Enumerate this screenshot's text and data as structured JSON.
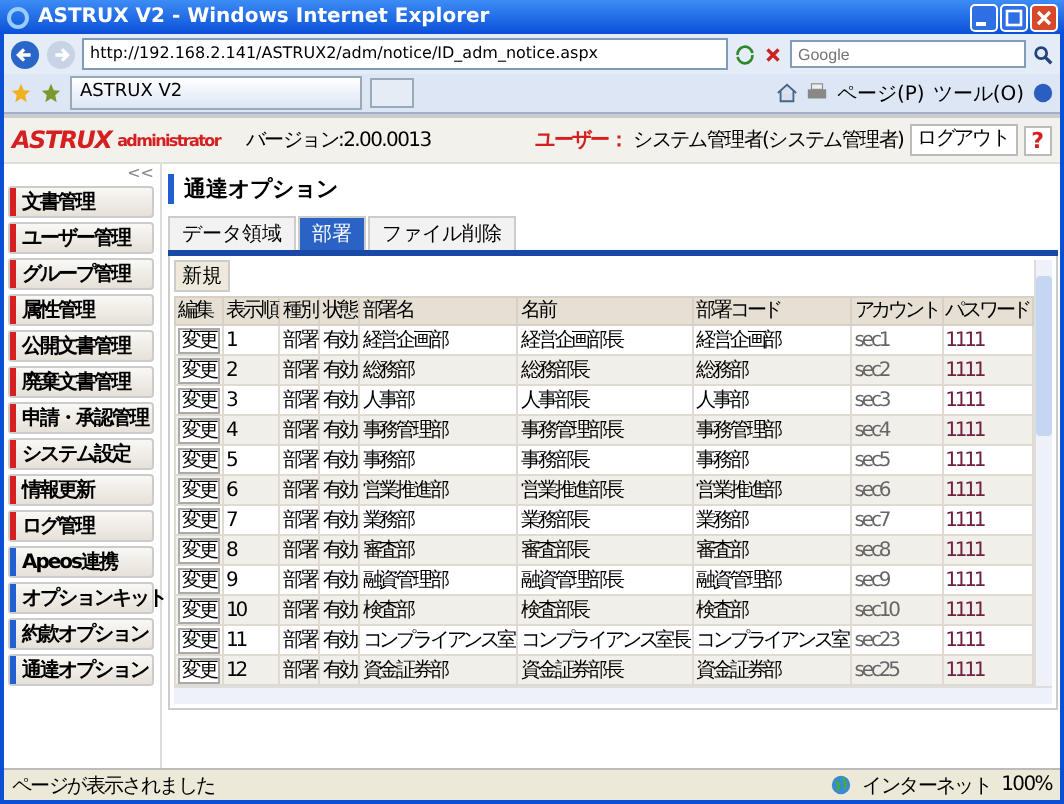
{
  "window": {
    "title": "ASTRUX V2 - Windows Internet Explorer"
  },
  "browser": {
    "address": "http://192.168.2.141/ASTRUX2/adm/notice/ID_adm_notice.aspx",
    "search_placeholder": "Google",
    "tab": "ASTRUX V2",
    "page_menu": "ページ(P)",
    "tools_menu": "ツール(O)"
  },
  "header": {
    "logo": "ASTRUX",
    "logo_sub": "administrator",
    "version": "バージョン:2.00.0013",
    "user_label": "ユーザー：",
    "user": "システム管理者(システム管理者)",
    "logout": "ログアウト",
    "help": "?"
  },
  "sidebar": {
    "collapse": "<<",
    "items": [
      {
        "label": "文書管理",
        "color": "#d42020"
      },
      {
        "label": "ユーザー管理",
        "color": "#d42020"
      },
      {
        "label": "グループ管理",
        "color": "#d42020"
      },
      {
        "label": "属性管理",
        "color": "#d42020"
      },
      {
        "label": "公開文書管理",
        "color": "#d42020"
      },
      {
        "label": "廃棄文書管理",
        "color": "#d42020"
      },
      {
        "label": "申請・承認管理",
        "color": "#d42020"
      },
      {
        "label": "システム設定",
        "color": "#d42020"
      },
      {
        "label": "情報更新",
        "color": "#d42020"
      },
      {
        "label": "ログ管理",
        "color": "#d42020"
      },
      {
        "label": "Apeos連携",
        "color": "#2060d0"
      },
      {
        "label": "オプションキット",
        "color": "#2060d0"
      },
      {
        "label": "約款オプション",
        "color": "#2060d0"
      },
      {
        "label": "通達オプション",
        "color": "#2060d0"
      }
    ]
  },
  "page_title": "通達オプション",
  "tabs": [
    {
      "label": "データ領域",
      "selected": false
    },
    {
      "label": "部署",
      "selected": true
    },
    {
      "label": "ファイル削除",
      "selected": false
    }
  ],
  "new_button": "新規",
  "table": {
    "columns": [
      "編集",
      "表示順",
      "種別",
      "状態",
      "部署名",
      "名前",
      "部署コード",
      "アカウント",
      "パスワード"
    ],
    "rows": [
      [
        "変更",
        "1",
        "部署",
        "有効",
        "経営企画部",
        "経営企画部長",
        "経営企画部",
        "sec1",
        "1111"
      ],
      [
        "変更",
        "2",
        "部署",
        "有効",
        "総務部",
        "総務部長",
        "総務部",
        "sec2",
        "1111"
      ],
      [
        "変更",
        "3",
        "部署",
        "有効",
        "人事部",
        "人事部長",
        "人事部",
        "sec3",
        "1111"
      ],
      [
        "変更",
        "4",
        "部署",
        "有効",
        "事務管理部",
        "事務管理部長",
        "事務管理部",
        "sec4",
        "1111"
      ],
      [
        "変更",
        "5",
        "部署",
        "有効",
        "事務部",
        "事務部長",
        "事務部",
        "sec5",
        "1111"
      ],
      [
        "変更",
        "6",
        "部署",
        "有効",
        "営業推進部",
        "営業推進部長",
        "営業推進部",
        "sec6",
        "1111"
      ],
      [
        "変更",
        "7",
        "部署",
        "有効",
        "業務部",
        "業務部長",
        "業務部",
        "sec7",
        "1111"
      ],
      [
        "変更",
        "8",
        "部署",
        "有効",
        "審査部",
        "審査部長",
        "審査部",
        "sec8",
        "1111"
      ],
      [
        "変更",
        "9",
        "部署",
        "有効",
        "融資管理部",
        "融資管理部長",
        "融資管理部",
        "sec9",
        "1111"
      ],
      [
        "変更",
        "10",
        "部署",
        "有効",
        "検査部",
        "検査部長",
        "検査部",
        "sec10",
        "1111"
      ],
      [
        "変更",
        "11",
        "部署",
        "有効",
        "コンプライアンス室",
        "コンプライアンス室長",
        "コンプライアンス室",
        "sec23",
        "1111"
      ],
      [
        "変更",
        "12",
        "部署",
        "有効",
        "資金証券部",
        "資金証券部長",
        "資金証券部",
        "sec25",
        "1111"
      ]
    ]
  },
  "status_bar": {
    "message": "ページが表示されました",
    "zone": "インターネット",
    "zoom": "100%"
  }
}
